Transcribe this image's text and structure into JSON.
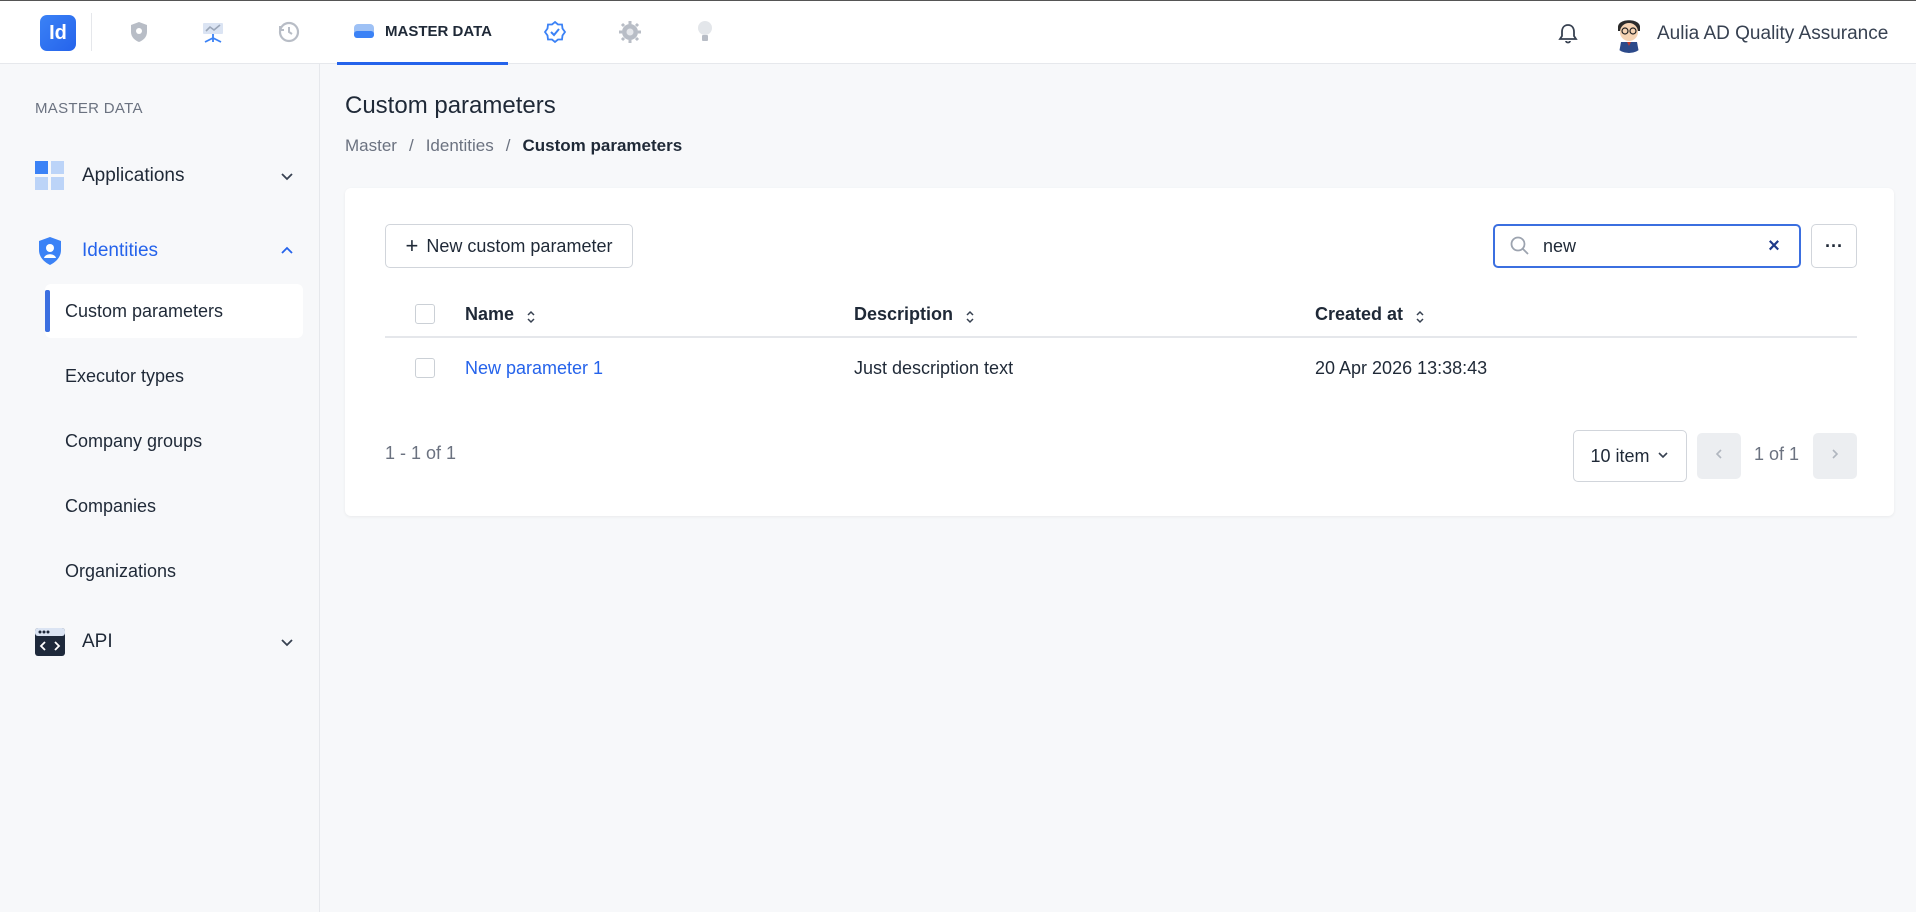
{
  "topbar": {
    "logo_text": "Id",
    "active_tab_label": "MASTER DATA",
    "user_name": "Aulia AD Quality Assurance",
    "nav_icons": [
      "shield-icon",
      "network-icon",
      "history-icon",
      "database-icon",
      "badge-check-icon",
      "gear-icon",
      "bulb-icon"
    ]
  },
  "sidebar": {
    "heading": "MASTER DATA",
    "groups": {
      "applications": "Applications",
      "identities": "Identities",
      "api": "API"
    },
    "identities_items": [
      "Custom parameters",
      "Executor types",
      "Company groups",
      "Companies",
      "Organizations"
    ]
  },
  "page": {
    "title": "Custom parameters",
    "breadcrumb": [
      "Master",
      "Identities",
      "Custom parameters"
    ],
    "breadcrumb_separator": "/"
  },
  "toolbar": {
    "new_button_label": "New custom parameter",
    "new_button_icon": "+",
    "search_value": "new",
    "clear_icon": "×",
    "more_label": "···"
  },
  "table": {
    "columns": [
      "Name",
      "Description",
      "Created at"
    ],
    "rows": [
      {
        "name": "New parameter 1",
        "description": "Just description text",
        "created_at": "20 Apr 2026 13:38:43"
      }
    ]
  },
  "pagination": {
    "range_text": "1 - 1 of 1",
    "per_page": "10 item",
    "page_info": "1 of 1"
  },
  "colors": {
    "accent": "#2563eb",
    "background": "#f7f8fa"
  }
}
